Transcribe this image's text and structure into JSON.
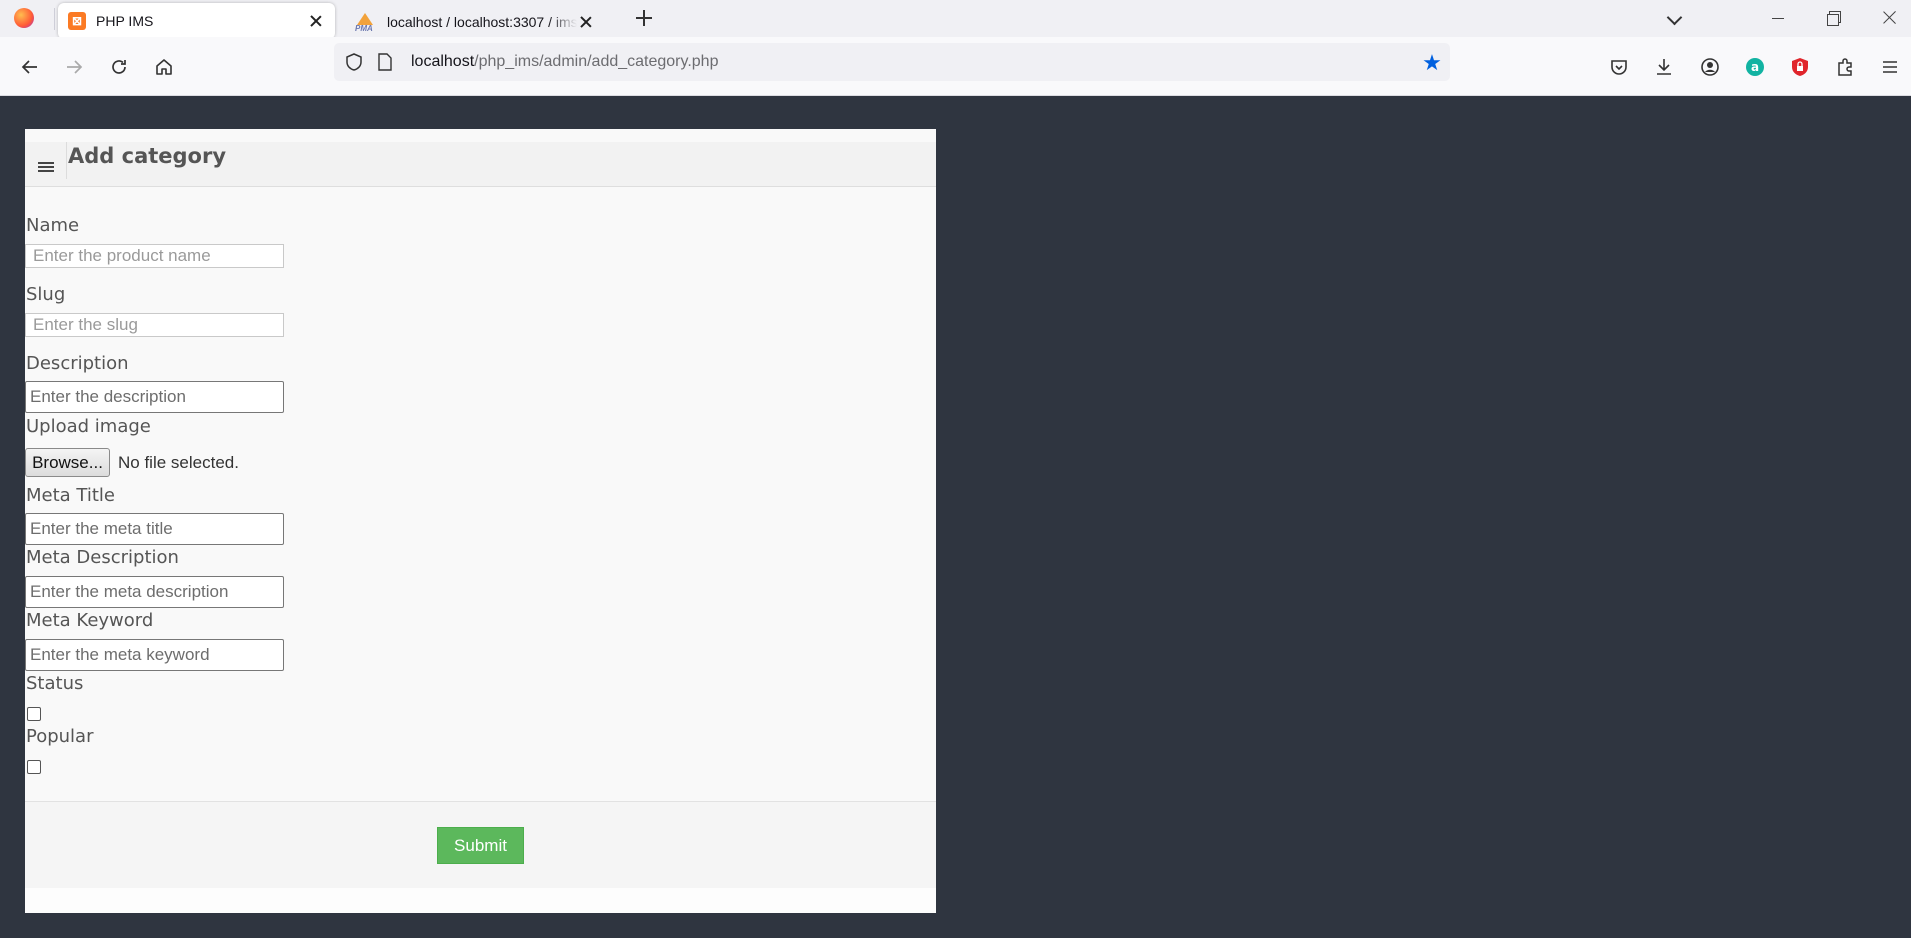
{
  "browser": {
    "tabs": [
      {
        "title": "PHP IMS",
        "active": true
      },
      {
        "title": "localhost / localhost:3307 / ims",
        "active": false
      }
    ],
    "url": {
      "host": "localhost",
      "path": "/php_ims/admin/add_category.php"
    }
  },
  "page": {
    "title": "Add category",
    "fields": {
      "name": {
        "label": "Name",
        "placeholder": "Enter the product name"
      },
      "slug": {
        "label": "Slug",
        "placeholder": "Enter the slug"
      },
      "description": {
        "label": "Description",
        "placeholder": "Enter the description"
      },
      "image": {
        "label": "Upload image",
        "button": "Browse...",
        "status": "No file selected."
      },
      "meta_title": {
        "label": "Meta Title",
        "placeholder": "Enter the meta title"
      },
      "meta_description": {
        "label": "Meta Description",
        "placeholder": "Enter the meta description"
      },
      "meta_keyword": {
        "label": "Meta Keyword",
        "placeholder": "Enter the meta keyword"
      },
      "status": {
        "label": "Status",
        "checked": false
      },
      "popular": {
        "label": "Popular",
        "checked": false
      }
    },
    "submit_label": "Submit"
  },
  "colors": {
    "page_bg": "#2f3540",
    "submit": "#5cb85c",
    "bookmark_star": "#0060df"
  }
}
